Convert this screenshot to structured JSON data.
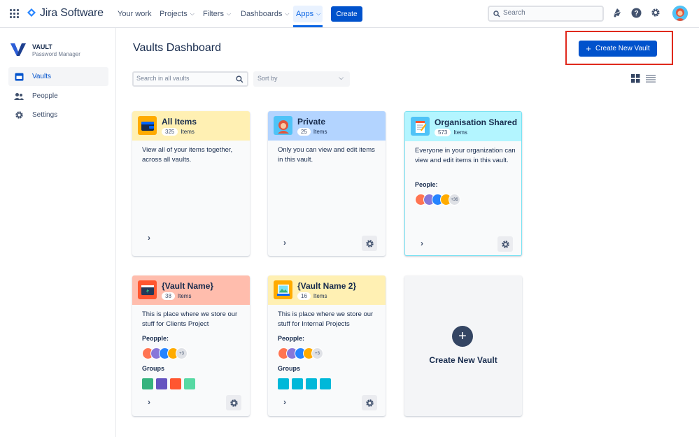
{
  "topbar": {
    "product": "Jira Software",
    "nav": [
      "Your work",
      "Projects",
      "Filters",
      "Dashboards",
      "Apps"
    ],
    "create_label": "Create",
    "search_placeholder": "Search"
  },
  "sidebar": {
    "brand_title": "VAULT",
    "brand_subtitle": "Password Manager",
    "items": [
      {
        "label": "Vaults",
        "icon": "vault-icon",
        "active": true
      },
      {
        "label": "Peopple",
        "icon": "people-icon"
      },
      {
        "label": "Settings",
        "icon": "gear-icon"
      }
    ]
  },
  "main": {
    "title": "Vaults Dashboard",
    "create_vault_label": "Create New Vault",
    "search_placeholder": "Search in all vaults",
    "sort_placeholder": "Sort by"
  },
  "cards": [
    {
      "title": "All Items",
      "count": "325",
      "count_unit": "Items",
      "desc": "View all of your items together, across all vaults.",
      "color": "#fff0b3"
    },
    {
      "title": "Private",
      "count": "25",
      "count_unit": "Items",
      "desc": "Only you can view and edit items in this vault.",
      "color": "#b3d4ff"
    },
    {
      "title": "Organisation Shared",
      "count": "573",
      "count_unit": "Items",
      "desc": "Everyone in your organization can view and edit items in this vault.",
      "people_label": "People:",
      "more": "+36",
      "color": "#b3f5ff"
    },
    {
      "title": "{Vault Name}",
      "count": "38",
      "count_unit": "Items",
      "desc": "This is place where we store our stuff for Clients Project",
      "people_label": "Peopple:",
      "more": "+3",
      "groups_label": "Groups",
      "color": "#ffbdad"
    },
    {
      "title": "{Vault Name 2}",
      "count": "16",
      "count_unit": "Items",
      "desc": "This is place where we store our stuff for Internal Projects",
      "people_label": "Peopple:",
      "more": "+3",
      "groups_label": "Groups",
      "color": "#fff0b3"
    }
  ],
  "new_card_label": "Create New Vault"
}
